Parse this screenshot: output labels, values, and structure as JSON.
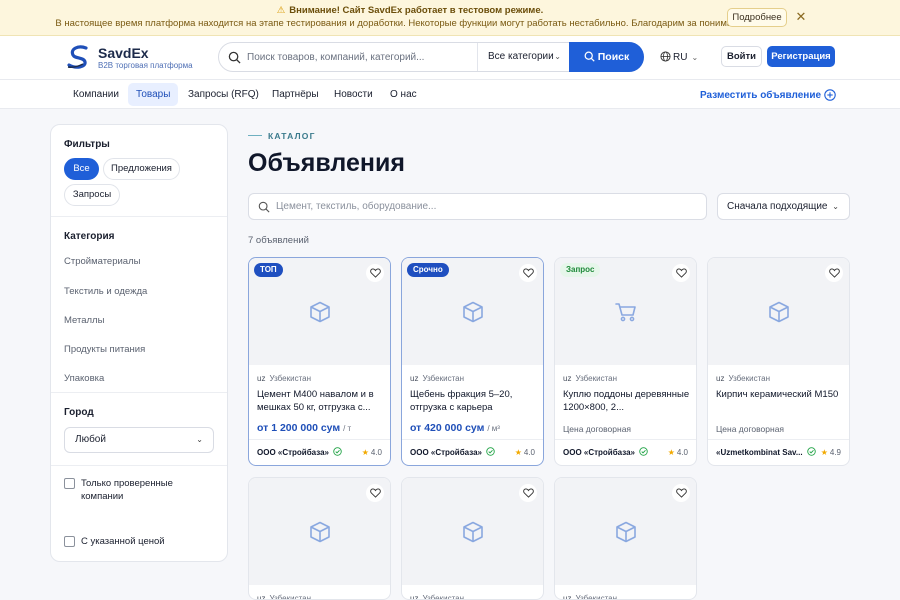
{
  "banner": {
    "title": "Внимание! Сайт SavdEx работает в тестовом режиме.",
    "text": "В настоящее время платформа находится на этапе тестирования и доработки. Некоторые функции могут работать нестабильно. Благодарим за понимание!",
    "more_label": "Подробнее",
    "close_label": "✕"
  },
  "header": {
    "brand": "SavdEx",
    "tagline": "B2B торговая платформа",
    "search_placeholder": "Поиск товаров, компаний, категорий...",
    "category_select": "Все категории",
    "search_button": "Поиск",
    "language": "RU",
    "login": "Войти",
    "register": "Регистрация"
  },
  "nav": {
    "items": [
      "Компании",
      "Товары",
      "Запросы (RFQ)",
      "Партнёры",
      "Новости",
      "О нас"
    ],
    "active": "Товары",
    "post_label": "Разместить объявление"
  },
  "sidebar": {
    "filters_title": "Фильтры",
    "type_chips": [
      "Все",
      "Предложения",
      "Запросы"
    ],
    "active_chip": "Все",
    "category_title": "Категория",
    "categories": [
      "Стройматериалы",
      "Текстиль и одежда",
      "Металлы",
      "Продукты питания",
      "Упаковка"
    ],
    "city_title": "Город",
    "city_value": "Любой",
    "verified_label": "Только проверенные компании",
    "priced_label": "С указанной ценой"
  },
  "main": {
    "kicker": "КАТАЛОГ",
    "title": "Объявления",
    "search_placeholder": "Цемент, текстиль, оборудование...",
    "sort_label": "Сначала подходящие",
    "count": "7 объявлений"
  },
  "listings": [
    {
      "badge": "ТОП",
      "badge_style": "blue",
      "highlight": true,
      "image_icon": "box-icon",
      "country_code": "uz",
      "country": "Узбекистан",
      "title": "Цемент М400 навалом и в мешках 50 кг, отгрузка с...",
      "price": "от 1 200 000 сум",
      "unit": "/ т",
      "seller": "ООО «Стройбаза»",
      "verified": true,
      "rating": "4.0"
    },
    {
      "badge": "Срочно",
      "badge_style": "blue",
      "highlight": true,
      "image_icon": "box-icon",
      "country_code": "uz",
      "country": "Узбекистан",
      "title": "Щебень фракция 5–20, отгрузка с карьера",
      "price": "от 420 000 сум",
      "unit": "/ м³",
      "seller": "ООО «Стройбаза»",
      "verified": true,
      "rating": "4.0"
    },
    {
      "badge": "Запрос",
      "badge_style": "green",
      "highlight": false,
      "image_icon": "cart-icon",
      "country_code": "uz",
      "country": "Узбекистан",
      "title": "Куплю поддоны деревянные 1200×800, 2...",
      "negotiable": "Цена договорная",
      "seller": "ООО «Стройбаза»",
      "verified": true,
      "rating": "4.0"
    },
    {
      "badge": "",
      "badge_style": "",
      "highlight": false,
      "image_icon": "box-icon",
      "country_code": "uz",
      "country": "Узбекистан",
      "title": "Кирпич керамический М150",
      "negotiable": "Цена договорная",
      "seller": "«Uzmetkombinat Sav...",
      "verified": true,
      "rating": "4.9"
    },
    {
      "badge": "",
      "badge_style": "",
      "highlight": false,
      "image_icon": "box-icon",
      "country_code": "uz",
      "country": "Узбекистан"
    },
    {
      "badge": "",
      "badge_style": "",
      "highlight": false,
      "image_icon": "box-icon",
      "country_code": "uz",
      "country": "Узбекистан"
    },
    {
      "badge": "",
      "badge_style": "",
      "highlight": false,
      "image_icon": "box-icon",
      "country_code": "uz",
      "country": "Узбекистан"
    }
  ],
  "colors": {
    "accent": "#1f5fd8",
    "banner_bg": "#fdf6dd",
    "verified": "#22a447",
    "star": "#f2a900"
  }
}
